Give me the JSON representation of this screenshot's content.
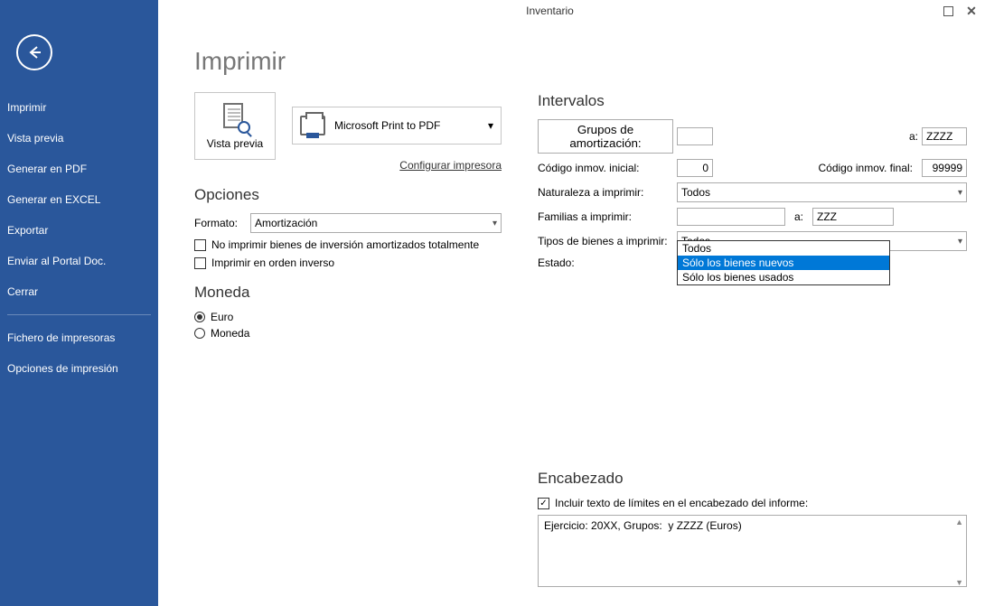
{
  "window": {
    "title": "Inventario"
  },
  "sidebar": {
    "items": [
      {
        "label": "Imprimir"
      },
      {
        "label": "Vista previa"
      },
      {
        "label": "Generar en PDF"
      },
      {
        "label": "Generar en EXCEL"
      },
      {
        "label": "Exportar"
      },
      {
        "label": "Enviar al Portal Doc."
      },
      {
        "label": "Cerrar"
      }
    ],
    "items2": [
      {
        "label": "Fichero de impresoras"
      },
      {
        "label": "Opciones de impresión"
      }
    ]
  },
  "page": {
    "title": "Imprimir"
  },
  "preview": {
    "label": "Vista previa"
  },
  "printer": {
    "selected": "Microsoft Print to PDF",
    "config_link": "Configurar impresora"
  },
  "opciones": {
    "heading": "Opciones",
    "format_label": "Formato:",
    "format_value": "Amortización",
    "chk1": "No imprimir bienes de inversión amortizados totalmente",
    "chk2": "Imprimir en orden inverso"
  },
  "moneda": {
    "heading": "Moneda",
    "euro": "Euro",
    "moneda": "Moneda",
    "selected": "euro"
  },
  "intervalos": {
    "heading": "Intervalos",
    "grupos_btn": "Grupos de amortización:",
    "grupos_from": "",
    "a_label": "a:",
    "grupos_to": "ZZZZ",
    "cod_ini_label": "Código inmov. inicial:",
    "cod_ini_val": "0",
    "cod_fin_label": "Código inmov. final:",
    "cod_fin_val": "99999",
    "nat_label": "Naturaleza a imprimir:",
    "nat_val": "Todos",
    "fam_label": "Familias a imprimir:",
    "fam_from": "",
    "fam_to": "ZZZ",
    "tipo_label": "Tipos de bienes a imprimir:",
    "tipo_val": "Todos",
    "tipo_options": [
      "Todos",
      "Sólo los bienes nuevos",
      "Sólo los bienes usados"
    ],
    "tipo_selected_index": 1,
    "estado_label": "Estado:"
  },
  "encabezado": {
    "heading": "Encabezado",
    "chk": "Incluir texto de límites en el encabezado del informe:",
    "text": "Ejercicio: 20XX, Grupos:  y ZZZZ (Euros)"
  }
}
